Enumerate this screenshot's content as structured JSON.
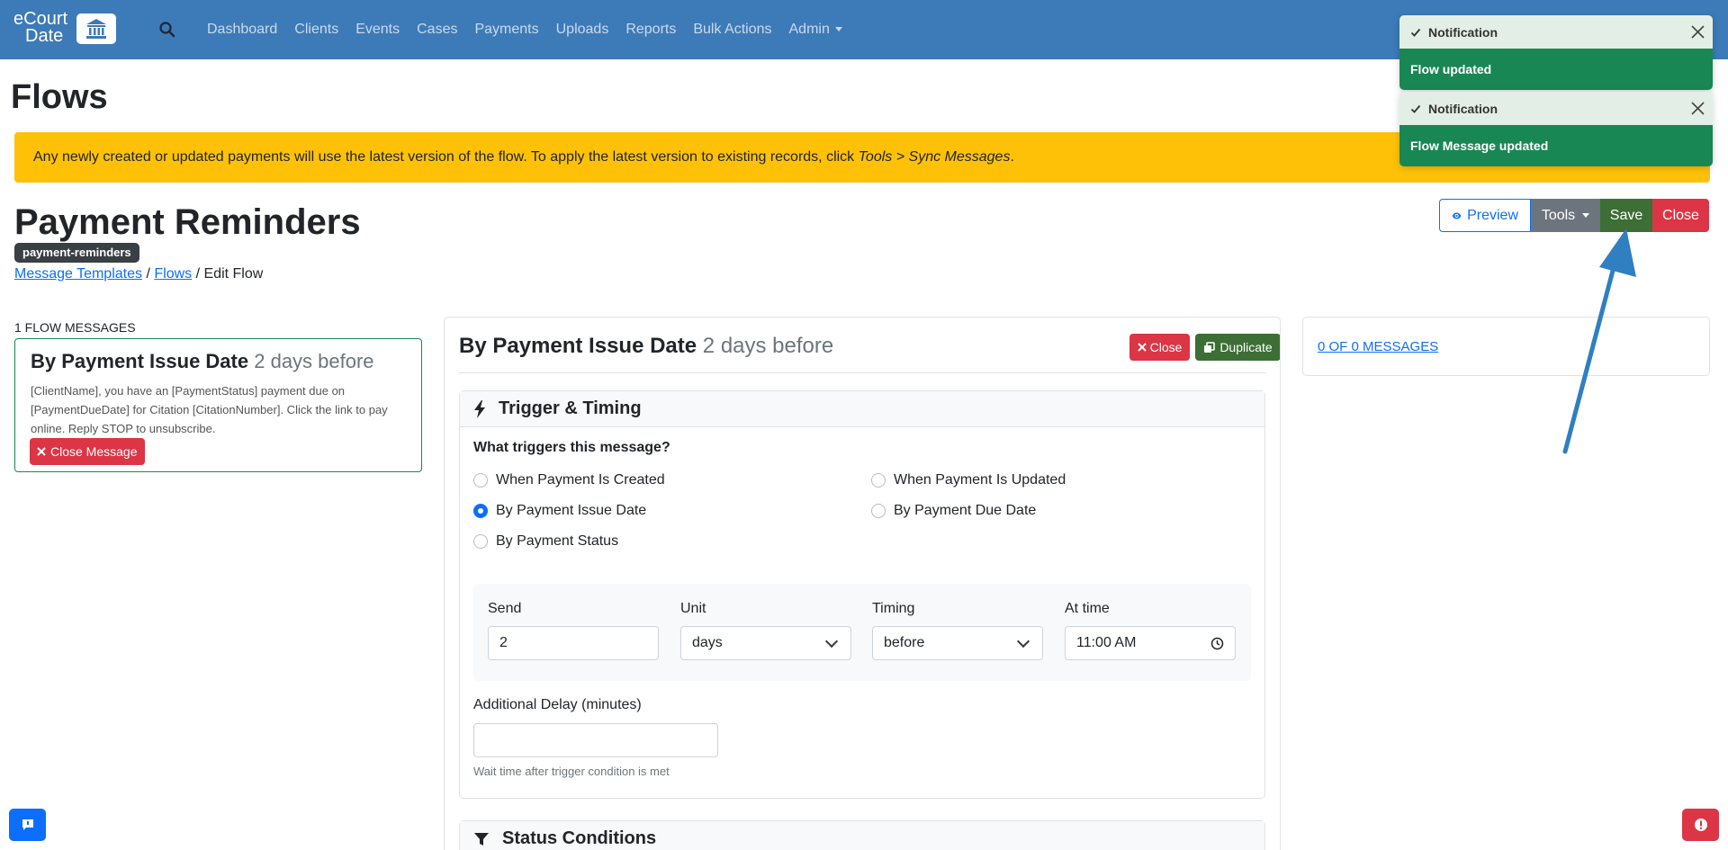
{
  "brand": {
    "line1": "eCourt",
    "line2": "Date"
  },
  "nav": {
    "items": [
      "Dashboard",
      "Clients",
      "Events",
      "Cases",
      "Payments",
      "Uploads",
      "Reports",
      "Bulk Actions"
    ],
    "admin_label": "Admin"
  },
  "page": {
    "title": "Flows"
  },
  "alert": {
    "text_before": "Any newly created or updated payments will use the latest version of the flow. To apply the latest version to existing records, click ",
    "emphasis": "Tools > Sync Messages",
    "text_after": "."
  },
  "flow": {
    "name": "Payment Reminders",
    "slug": "payment-reminders",
    "breadcrumb": {
      "link1": "Message Templates",
      "sep": "/",
      "link2": "Flows",
      "current": "Edit Flow"
    }
  },
  "actions": {
    "preview": "Preview",
    "tools": "Tools",
    "save": "Save",
    "close": "Close"
  },
  "messages_list": {
    "count_label": "1 Flow Messages",
    "items": [
      {
        "title": "By Payment Issue Date",
        "timing": "2 days before",
        "body": "[ClientName], you have an [PaymentStatus] payment due on [PaymentDueDate] for Citation [CitationNumber]. Click the link to pay online. Reply STOP to unsubscribe.",
        "close_label": "Close Message"
      }
    ]
  },
  "editor": {
    "title": "By Payment Issue Date",
    "timing": "2 days before",
    "close_label": "Close",
    "duplicate_label": "Duplicate",
    "trigger_section": {
      "title": "Trigger & Timing",
      "question": "What triggers this message?",
      "options": [
        {
          "label": "When Payment Is Created",
          "checked": false
        },
        {
          "label": "When Payment Is Updated",
          "checked": false
        },
        {
          "label": "By Payment Issue Date",
          "checked": true
        },
        {
          "label": "By Payment Due Date",
          "checked": false
        },
        {
          "label": "By Payment Status",
          "checked": false
        }
      ],
      "send": {
        "label": "Send",
        "value": "2"
      },
      "unit": {
        "label": "Unit",
        "value": "days"
      },
      "timing": {
        "label": "Timing",
        "value": "before"
      },
      "at_time": {
        "label": "At time",
        "value": "11:00 AM"
      },
      "delay": {
        "label": "Additional Delay (minutes)",
        "value": "",
        "help": "Wait time after trigger condition is met"
      }
    },
    "status_section": {
      "title": "Status Conditions"
    }
  },
  "preview_panel": {
    "link": "0 of 0 Messages"
  },
  "notifications": [
    {
      "header": "Notification",
      "body": "Flow updated"
    },
    {
      "header": "Notification",
      "body": "Flow Message updated"
    }
  ],
  "colors": {
    "navbar": "#3d7ab8",
    "alert": "#ffc107",
    "save": "#3c6e35",
    "danger": "#dc3545",
    "primary": "#0d6efd",
    "toast_body": "#198754",
    "arrow": "#2f7fc1"
  },
  "icons": {
    "logo": "courthouse-icon",
    "search": "search-icon",
    "preview": "eye-icon",
    "duplicate": "copy-icon",
    "close": "x-icon",
    "trigger": "bolt-icon",
    "status": "filter-icon",
    "clock": "clock-icon",
    "toast_check": "check-icon",
    "toast_close": "close-icon",
    "feedback": "chat-icon",
    "alert": "exclamation-icon"
  }
}
